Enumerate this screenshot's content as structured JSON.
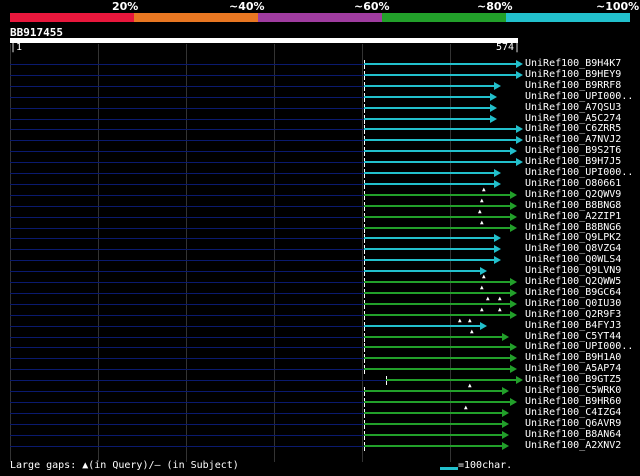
{
  "legend": {
    "labels": [
      "20%",
      "~40%",
      "~60%",
      "~80%",
      "~100%"
    ],
    "colors": [
      "#e8173c",
      "#e87722",
      "#a03ca0",
      "#22a02a",
      "#22c0cc"
    ]
  },
  "query": {
    "name": "BB917455",
    "start": "|1",
    "end": "574|"
  },
  "hits": [
    {
      "label": "UniRef100_B9H4K7",
      "color": "#22c0cc",
      "start": 364,
      "end": 516,
      "gaps": []
    },
    {
      "label": "UniRef100_B9HEY9",
      "color": "#22c0cc",
      "start": 364,
      "end": 516,
      "gaps": []
    },
    {
      "label": "UniRef100_B9RRF8",
      "color": "#22c0cc",
      "start": 364,
      "end": 494,
      "gaps": []
    },
    {
      "label": "UniRef100_UPI000..",
      "color": "#22c0cc",
      "start": 364,
      "end": 490,
      "gaps": []
    },
    {
      "label": "UniRef100_A7QSU3",
      "color": "#22c0cc",
      "start": 364,
      "end": 490,
      "gaps": []
    },
    {
      "label": "UniRef100_A5C274",
      "color": "#22c0cc",
      "start": 364,
      "end": 490,
      "gaps": []
    },
    {
      "label": "UniRef100_C6ZRR5",
      "color": "#22c0cc",
      "start": 364,
      "end": 516,
      "gaps": []
    },
    {
      "label": "UniRef100_A7NVJ2",
      "color": "#22c0cc",
      "start": 364,
      "end": 516,
      "gaps": []
    },
    {
      "label": "UniRef100_B9S2T6",
      "color": "#22c0cc",
      "start": 364,
      "end": 510,
      "gaps": []
    },
    {
      "label": "UniRef100_B9H7J5",
      "color": "#22c0cc",
      "start": 364,
      "end": 516,
      "gaps": []
    },
    {
      "label": "UniRef100_UPI000..",
      "color": "#22c0cc",
      "start": 364,
      "end": 494,
      "gaps": []
    },
    {
      "label": "UniRef100_O80661",
      "color": "#22c0cc",
      "start": 364,
      "end": 494,
      "gaps": []
    },
    {
      "label": "UniRef100_Q2QWV9",
      "color": "#22a02a",
      "start": 364,
      "end": 510,
      "gaps": [
        484
      ]
    },
    {
      "label": "UniRef100_B8BNG8",
      "color": "#22a02a",
      "start": 364,
      "end": 510,
      "gaps": [
        482
      ]
    },
    {
      "label": "UniRef100_A2ZIP1",
      "color": "#22a02a",
      "start": 364,
      "end": 510,
      "gaps": [
        480
      ]
    },
    {
      "label": "UniRef100_B8BNG6",
      "color": "#22a02a",
      "start": 364,
      "end": 510,
      "gaps": [
        482
      ]
    },
    {
      "label": "UniRef100_Q9LPK2",
      "color": "#22c0cc",
      "start": 364,
      "end": 494,
      "gaps": []
    },
    {
      "label": "UniRef100_Q8VZG4",
      "color": "#22c0cc",
      "start": 364,
      "end": 494,
      "gaps": []
    },
    {
      "label": "UniRef100_Q0WLS4",
      "color": "#22c0cc",
      "start": 364,
      "end": 494,
      "gaps": []
    },
    {
      "label": "UniRef100_Q9LVN9",
      "color": "#22c0cc",
      "start": 364,
      "end": 480,
      "gaps": []
    },
    {
      "label": "UniRef100_Q2QWW5",
      "color": "#22a02a",
      "start": 364,
      "end": 510,
      "gaps": [
        484
      ]
    },
    {
      "label": "UniRef100_B9GC64",
      "color": "#22a02a",
      "start": 364,
      "end": 510,
      "gaps": [
        482
      ]
    },
    {
      "label": "UniRef100_Q0IU30",
      "color": "#22a02a",
      "start": 364,
      "end": 510,
      "gaps": [
        488,
        500
      ]
    },
    {
      "label": "UniRef100_Q2R9F3",
      "color": "#22a02a",
      "start": 364,
      "end": 510,
      "gaps": [
        482,
        500
      ]
    },
    {
      "label": "UniRef100_B4FYJ3",
      "color": "#22c0cc",
      "start": 364,
      "end": 480,
      "gaps": [
        460,
        470
      ]
    },
    {
      "label": "UniRef100_C5YT44",
      "color": "#22a02a",
      "start": 364,
      "end": 502,
      "gaps": [
        472
      ]
    },
    {
      "label": "UniRef100_UPI000..",
      "color": "#22a02a",
      "start": 364,
      "end": 510,
      "gaps": []
    },
    {
      "label": "UniRef100_B9H1A0",
      "color": "#22a02a",
      "start": 364,
      "end": 510,
      "gaps": []
    },
    {
      "label": "UniRef100_A5AP74",
      "color": "#22a02a",
      "start": 364,
      "end": 510,
      "gaps": []
    },
    {
      "label": "UniRef100_B9GTZ5",
      "color": "#22a02a",
      "start": 386,
      "end": 516,
      "gaps": []
    },
    {
      "label": "UniRef100_C5WRK0",
      "color": "#22a02a",
      "start": 364,
      "end": 502,
      "gaps": [
        470
      ]
    },
    {
      "label": "UniRef100_B9HR60",
      "color": "#22a02a",
      "start": 364,
      "end": 510,
      "gaps": []
    },
    {
      "label": "UniRef100_C4IZG4",
      "color": "#22a02a",
      "start": 364,
      "end": 502,
      "gaps": [
        466
      ]
    },
    {
      "label": "UniRef100_Q6AVR9",
      "color": "#22a02a",
      "start": 364,
      "end": 502,
      "gaps": []
    },
    {
      "label": "UniRef100_B8AN64",
      "color": "#22a02a",
      "start": 364,
      "end": 502,
      "gaps": []
    },
    {
      "label": "UniRef100_A2XNV2",
      "color": "#22a02a",
      "start": 364,
      "end": 502,
      "gaps": []
    }
  ],
  "footer": {
    "gaps_text": "Large gaps: ▲(in Query)/– (in Subject)",
    "scale_text": "=100char.",
    "scale_color": "#22c0cc"
  }
}
